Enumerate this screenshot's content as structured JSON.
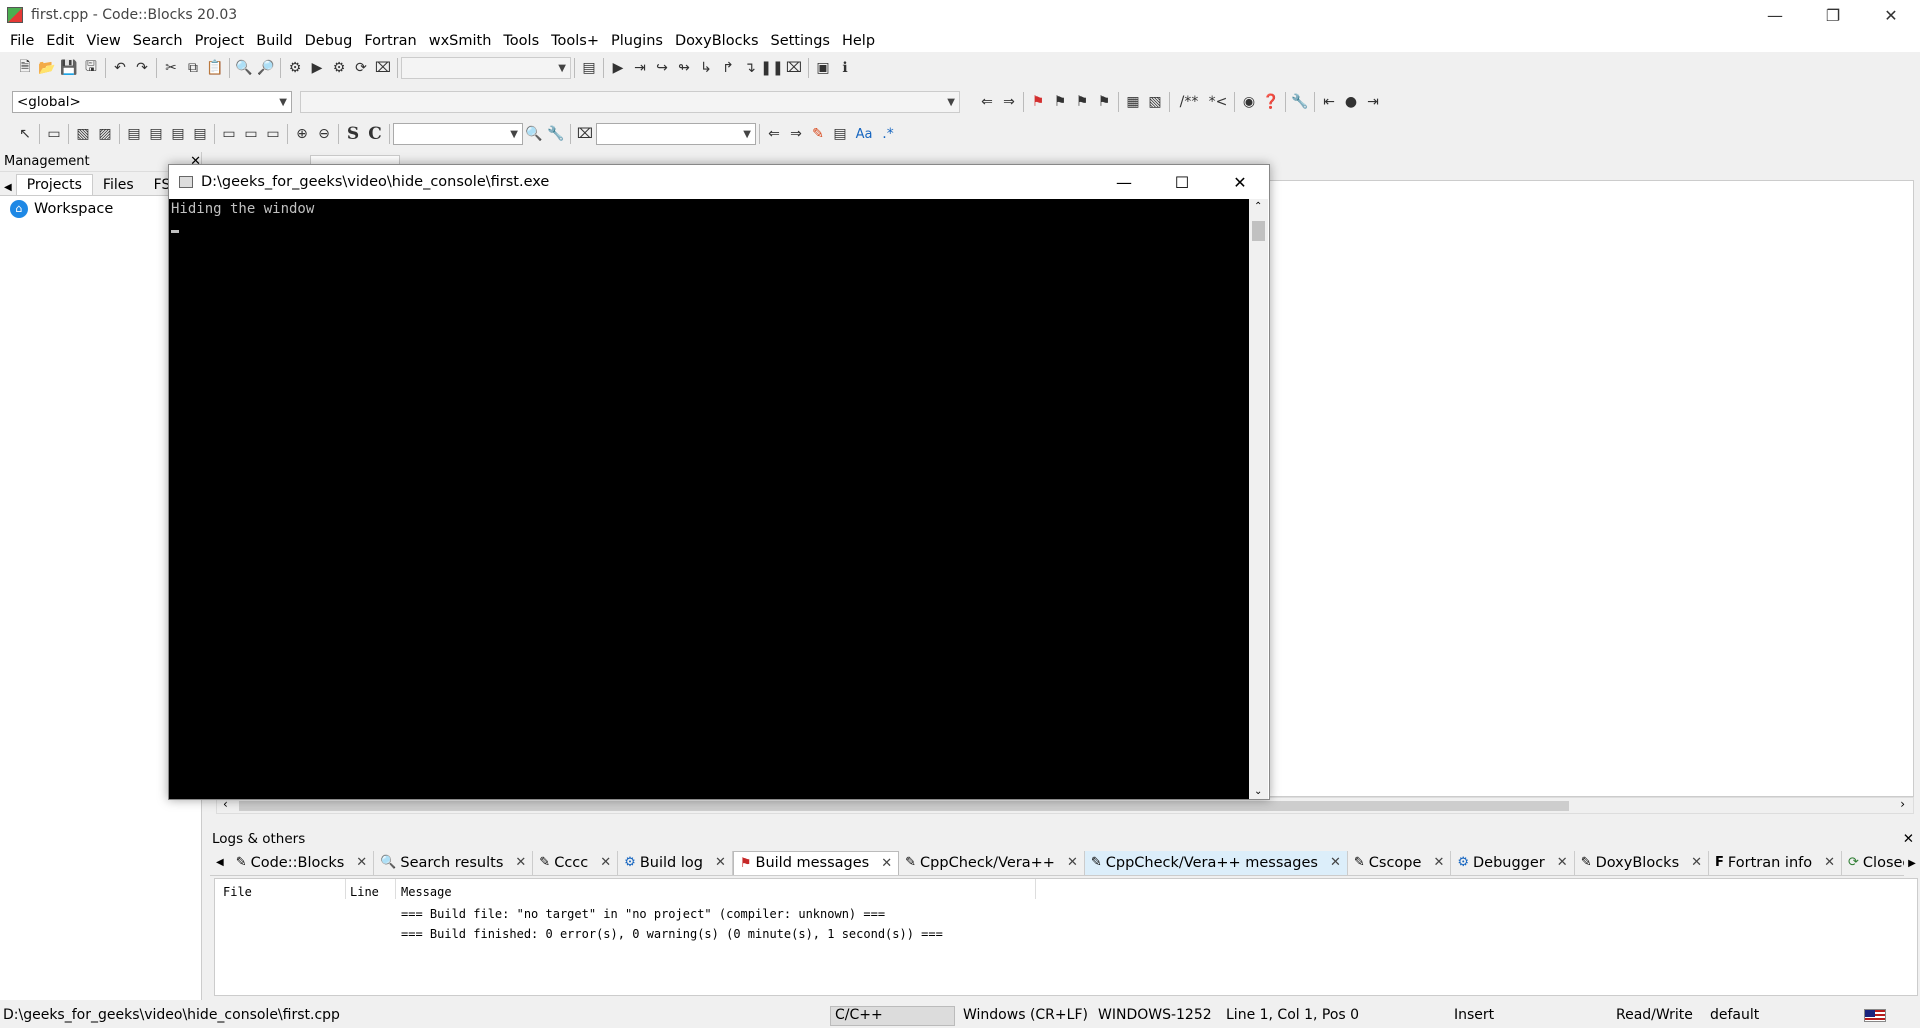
{
  "window": {
    "title": "first.cpp - Code::Blocks 20.03"
  },
  "menu": [
    "File",
    "Edit",
    "View",
    "Search",
    "Project",
    "Build",
    "Debug",
    "Fortran",
    "wxSmith",
    "Tools",
    "Tools+",
    "Plugins",
    "DoxyBlocks",
    "Settings",
    "Help"
  ],
  "code_toolbar": {
    "scope_value": "<global>",
    "function_value": ""
  },
  "management": {
    "title": "Management",
    "tabs": [
      "Projects",
      "Files",
      "FS"
    ],
    "tree": {
      "root": "Workspace"
    }
  },
  "console": {
    "title": "D:\\geeks_for_geeks\\video\\hide_console\\first.exe",
    "output": "Hiding the window"
  },
  "logs": {
    "title": "Logs & others",
    "tabs": [
      "Code::Blocks",
      "Search results",
      "Cccc",
      "Build log",
      "Build messages",
      "CppCheck/Vera++",
      "CppCheck/Vera++ messages",
      "Cscope",
      "Debugger",
      "DoxyBlocks",
      "Fortran info",
      "Closed files list"
    ],
    "active_tab": "Build messages",
    "columns": {
      "file": "File",
      "line": "Line",
      "message": "Message"
    },
    "messages": [
      "=== Build file: \"no target\" in \"no project\" (compiler: unknown) ===",
      "=== Build finished: 0 error(s), 0 warning(s) (0 minute(s), 1 second(s)) ==="
    ]
  },
  "status": {
    "path": "D:\\geeks_for_geeks\\video\\hide_console\\first.cpp",
    "language": "C/C++",
    "eol": "Windows (CR+LF)",
    "encoding": "WINDOWS-1252",
    "position": "Line 1, Col 1, Pos 0",
    "mode": "Insert",
    "access": "Read/Write",
    "profile": "default"
  }
}
